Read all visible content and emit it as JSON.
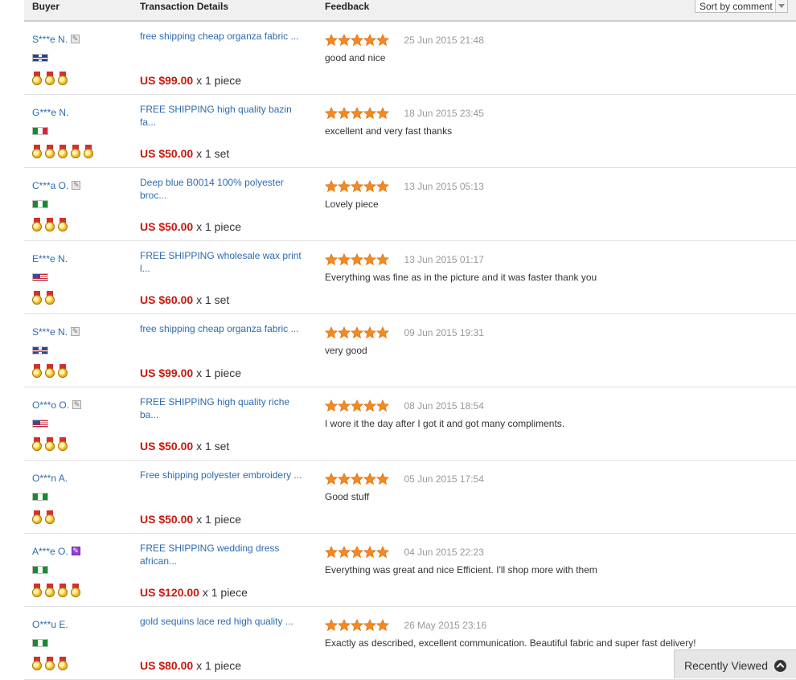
{
  "header": {
    "buyer": "Buyer",
    "transaction": "Transaction Details",
    "feedback": "Feedback",
    "sort_label": "Sort by comment"
  },
  "colors": {
    "link": "#2d6bb0",
    "price": "#c9190e",
    "star": "#f4891f",
    "date": "#999999"
  },
  "rows": [
    {
      "buyer": "S***e N.",
      "badge": "gray",
      "flag": "gb",
      "medals": 3,
      "title": "free shipping cheap organza fabric ...",
      "price": "US $99.00",
      "qty": "x 1 piece",
      "rating": 5,
      "date": "25 Jun 2015 21:48",
      "comment": "good and nice"
    },
    {
      "buyer": "G***e N.",
      "badge": "",
      "flag": "it",
      "medals": 5,
      "title": "FREE SHIPPING high quality bazin fa...",
      "price": "US $50.00",
      "qty": "x 1 set",
      "rating": 5,
      "date": "18 Jun 2015 23:45",
      "comment": "excellent and very fast thanks"
    },
    {
      "buyer": "C***a O.",
      "badge": "gray",
      "flag": "ng",
      "medals": 3,
      "title": "Deep blue B0014 100% polyester broc...",
      "price": "US $50.00",
      "qty": "x 1 piece",
      "rating": 5,
      "date": "13 Jun 2015 05:13",
      "comment": "Lovely piece"
    },
    {
      "buyer": "E***e N.",
      "badge": "",
      "flag": "us",
      "medals": 2,
      "title": "FREE SHIPPING wholesale wax print l...",
      "price": "US $60.00",
      "qty": "x 1 set",
      "rating": 5,
      "date": "13 Jun 2015 01:17",
      "comment": "Everything was fine as in the picture and it was faster thank you"
    },
    {
      "buyer": "S***e N.",
      "badge": "gray",
      "flag": "gb",
      "medals": 3,
      "title": "free shipping cheap organza fabric ...",
      "price": "US $99.00",
      "qty": "x 1 piece",
      "rating": 5,
      "date": "09 Jun 2015 19:31",
      "comment": "very good"
    },
    {
      "buyer": "O***o O.",
      "badge": "gray",
      "flag": "us",
      "medals": 3,
      "title": "FREE SHIPPING high quality riche ba...",
      "price": "US $50.00",
      "qty": "x 1 set",
      "rating": 5,
      "date": "08 Jun 2015 18:54",
      "comment": "I wore it the day after I got it and got many compliments."
    },
    {
      "buyer": "O***n A.",
      "badge": "",
      "flag": "ng",
      "medals": 2,
      "title": "Free shipping polyester embroidery ...",
      "price": "US $50.00",
      "qty": "x 1 piece",
      "rating": 5,
      "date": "05 Jun 2015 17:54",
      "comment": "Good stuff"
    },
    {
      "buyer": "A***e O.",
      "badge": "purple",
      "flag": "ng",
      "medals": 4,
      "title": "FREE SHIPPING wedding dress african...",
      "price": "US $120.00",
      "qty": "x 1 piece",
      "rating": 5,
      "date": "04 Jun 2015 22:23",
      "comment": "Everything was great and nice Efficient. I'll shop more with them"
    },
    {
      "buyer": "O***u E.",
      "badge": "",
      "flag": "ng",
      "medals": 3,
      "title": "gold sequins lace red high quality ...",
      "price": "US $80.00",
      "qty": "x 1 piece",
      "rating": 5,
      "date": "26 May 2015 23:16",
      "comment": "Exactly as described, excellent communication. Beautiful fabric and super fast delivery!"
    }
  ],
  "recently_viewed": {
    "label": "Recently Viewed",
    "icon": "chevron-up-circle-icon"
  }
}
